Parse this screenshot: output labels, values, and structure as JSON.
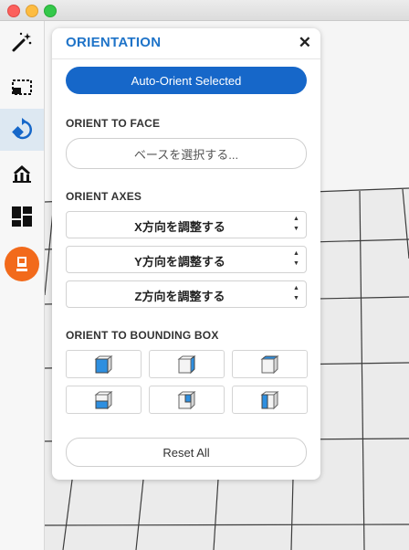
{
  "window": {
    "controls": [
      "close",
      "minimize",
      "zoom"
    ]
  },
  "toolbar": {
    "tools": [
      {
        "name": "magic-wand-icon",
        "active": false
      },
      {
        "name": "selection-icon",
        "active": false
      },
      {
        "name": "orientation-icon",
        "active": true
      },
      {
        "name": "support-icon",
        "active": false
      },
      {
        "name": "layout-icon",
        "active": false
      },
      {
        "name": "print-icon",
        "active": false
      }
    ],
    "accent": "#f26a1b"
  },
  "panel": {
    "title": "ORIENTATION",
    "close": "✕",
    "auto_orient_label": "Auto-Orient Selected",
    "face_section": {
      "label": "ORIENT TO FACE",
      "button": "ベースを選択する..."
    },
    "axes_section": {
      "label": "ORIENT AXES",
      "steppers": [
        "X方向を調整する",
        "Y方向を調整する",
        "Z方向を調整する"
      ]
    },
    "bbox_section": {
      "label": "ORIENT TO BOUNDING BOX",
      "faces": [
        "front",
        "right",
        "top",
        "bottom",
        "back",
        "left"
      ]
    },
    "reset_label": "Reset All"
  },
  "colors": {
    "accent": "#1e73c8",
    "primary_button": "#1667c9",
    "cube_highlight": "#2e8fe0"
  }
}
